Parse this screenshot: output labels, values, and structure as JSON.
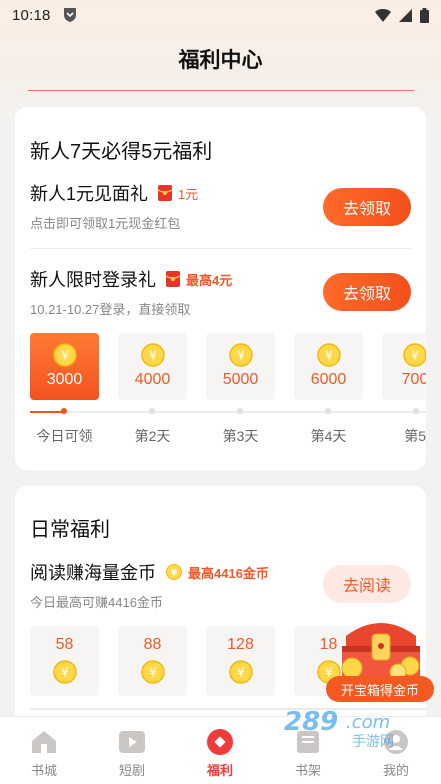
{
  "status_bar": {
    "time": "10:18"
  },
  "header": {
    "title": "福利中心"
  },
  "newbie_card": {
    "title": "新人7天必得5元福利",
    "tasks": [
      {
        "title": "新人1元见面礼",
        "badge": "1元",
        "desc": "点击即可领取1元现金红包",
        "button": "去领取"
      },
      {
        "title": "新人限时登录礼",
        "badge": "最高4元",
        "desc": "10.21-10.27登录，直接领取",
        "button": "去领取"
      }
    ],
    "days": [
      {
        "amount": "3000",
        "label": "今日可领"
      },
      {
        "amount": "4000",
        "label": "第2天"
      },
      {
        "amount": "5000",
        "label": "第3天"
      },
      {
        "amount": "6000",
        "label": "第4天"
      },
      {
        "amount": "700",
        "label": "第5"
      }
    ],
    "progress_fraction": 0.0
  },
  "daily_card": {
    "title": "日常福利",
    "read_task": {
      "title": "阅读赚海量金币",
      "badge": "最高4416金币",
      "desc": "今日最高可赚4416金币",
      "button": "去阅读"
    },
    "read_tiles": [
      "58",
      "88",
      "128",
      "18"
    ]
  },
  "treasure": {
    "label": "开宝箱得金币"
  },
  "tabs": [
    {
      "label": "书城",
      "icon": "home-icon"
    },
    {
      "label": "短剧",
      "icon": "video-icon"
    },
    {
      "label": "福利",
      "icon": "gift-icon",
      "active": true
    },
    {
      "label": "书架",
      "icon": "bookshelf-icon"
    },
    {
      "label": "我的",
      "icon": "profile-icon"
    }
  ],
  "colors": {
    "accent": "#f2531d",
    "active_tab": "#ef3b3b",
    "coin": "#f7c21c"
  },
  "watermark": {
    "text": "289.com 手游网"
  }
}
